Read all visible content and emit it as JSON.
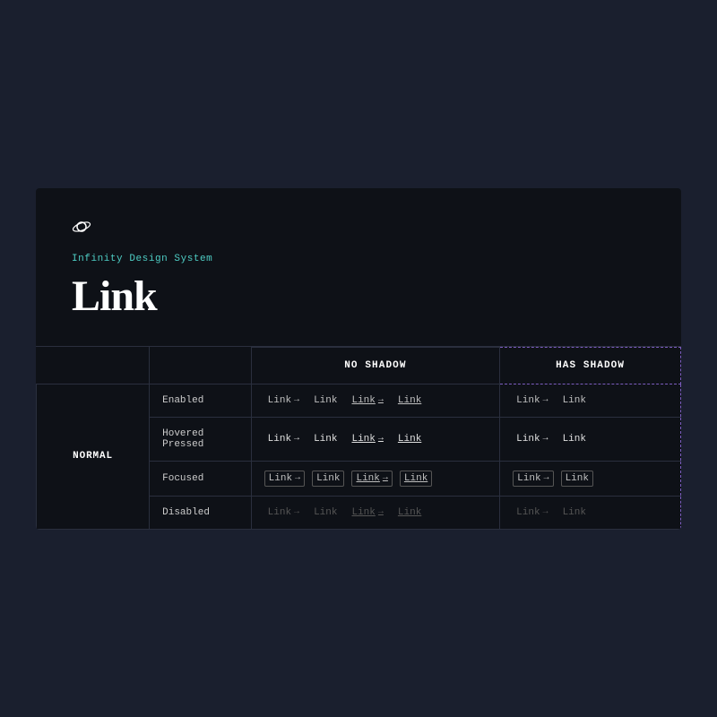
{
  "header": {
    "logo_icon": "⊙",
    "subtitle": "Infinity Design System",
    "title": "Link"
  },
  "table": {
    "col_headers": [
      "",
      "NO SHADOW",
      "HAS SHADOW"
    ],
    "rows": [
      {
        "row_label": "NORMAL",
        "states": [
          {
            "state": "Enabled",
            "no_shadow_links": [
              {
                "text": "Link",
                "arrow": true,
                "style": "enabled"
              },
              {
                "text": "Link",
                "arrow": false,
                "style": "enabled"
              },
              {
                "text": "Link",
                "arrow": true,
                "style": "enabled-underline"
              },
              {
                "text": "Link",
                "arrow": false,
                "style": "enabled-underline"
              }
            ],
            "has_shadow_links": [
              {
                "text": "Link",
                "arrow": true,
                "style": "enabled"
              },
              {
                "text": "Link",
                "arrow": false,
                "style": "enabled"
              }
            ]
          },
          {
            "state": "Hovered\nPressed",
            "no_shadow_links": [
              {
                "text": "Link",
                "arrow": true,
                "style": "hovered"
              },
              {
                "text": "Link",
                "arrow": false,
                "style": "hovered"
              },
              {
                "text": "Link",
                "arrow": true,
                "style": "hovered-underline"
              },
              {
                "text": "Link",
                "arrow": false,
                "style": "hovered-underline"
              }
            ],
            "has_shadow_links": [
              {
                "text": "Link",
                "arrow": true,
                "style": "hovered"
              },
              {
                "text": "Link",
                "arrow": false,
                "style": "hovered"
              }
            ]
          },
          {
            "state": "Focused",
            "no_shadow_links": [
              {
                "text": "Link",
                "arrow": true,
                "style": "focused"
              },
              {
                "text": "Link",
                "arrow": false,
                "style": "focused"
              },
              {
                "text": "Link",
                "arrow": true,
                "style": "focused-underline"
              },
              {
                "text": "Link",
                "arrow": false,
                "style": "focused-underline"
              }
            ],
            "has_shadow_links": [
              {
                "text": "Link",
                "arrow": true,
                "style": "focused"
              },
              {
                "text": "Link",
                "arrow": false,
                "style": "focused"
              }
            ]
          },
          {
            "state": "Disabled",
            "no_shadow_links": [
              {
                "text": "Link",
                "arrow": true,
                "style": "disabled"
              },
              {
                "text": "Link",
                "arrow": false,
                "style": "disabled"
              },
              {
                "text": "Link",
                "arrow": true,
                "style": "disabled-underline"
              },
              {
                "text": "Link",
                "arrow": false,
                "style": "disabled-underline"
              }
            ],
            "has_shadow_links": [
              {
                "text": "Link",
                "arrow": true,
                "style": "disabled"
              },
              {
                "text": "Link",
                "arrow": false,
                "style": "disabled"
              }
            ]
          }
        ]
      }
    ]
  },
  "colors": {
    "background": "#1a1f2e",
    "card": "#0e1117",
    "border": "#2a2f3e",
    "accent": "#4ecdc4",
    "purple_dashed": "#7c5cbf",
    "text_primary": "#ffffff",
    "text_secondary": "#cccccc",
    "text_muted": "#555555"
  }
}
